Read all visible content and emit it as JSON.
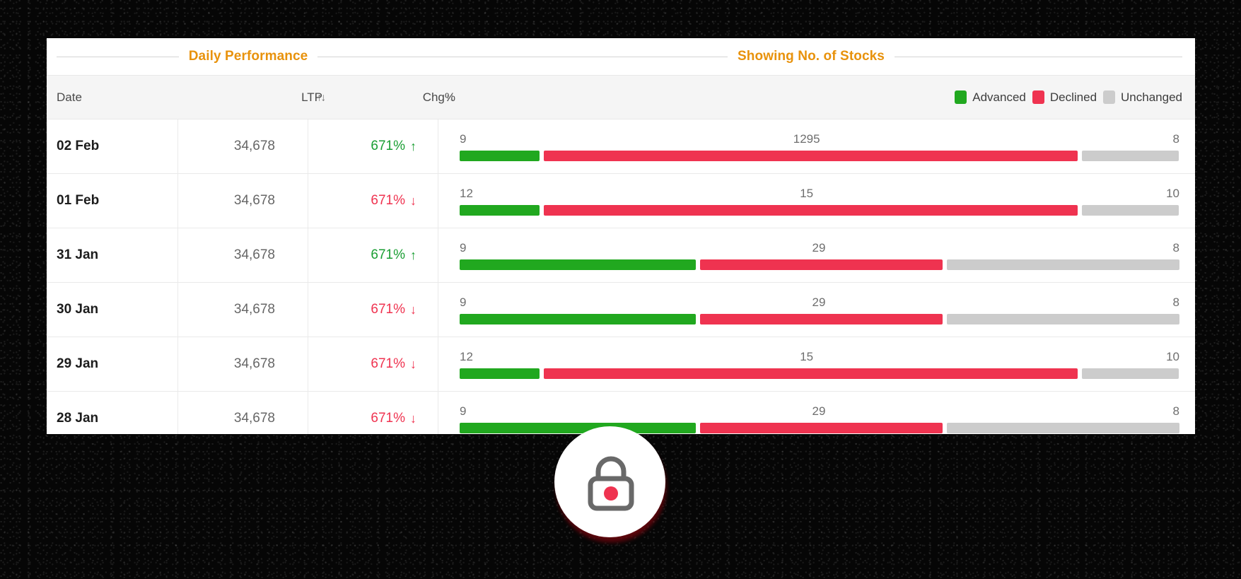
{
  "sections": {
    "left_title": "Daily Performance",
    "right_title": "Showing No. of Stocks",
    "accent_color": "#e8920c"
  },
  "table": {
    "columns": {
      "date": "Date",
      "ltp": "LTP",
      "chg": "Chg%",
      "sort_icon_ltp": "sort-updown-icon",
      "sort_icon_chg": "sort-updown-icon",
      "sort_glyph": "↑↓"
    },
    "legend": [
      {
        "label": "Advanced",
        "color": "#21a81f",
        "icon": "green-square-icon"
      },
      {
        "label": "Declined",
        "color": "#ef3350",
        "icon": "red-square-icon"
      },
      {
        "label": "Unchanged",
        "color": "#cccccc",
        "icon": "gray-square-icon"
      }
    ],
    "rows": [
      {
        "date": "02 Feb",
        "ltp": "34,678",
        "chg": "671%",
        "chg_direction": "up",
        "chg_arrow": "↑",
        "advanced": "9",
        "declined": "1295",
        "unchanged": "8",
        "adv_pct": 11.1,
        "dec_pct": 74.2,
        "unch_pct": 13.4
      },
      {
        "date": "01 Feb",
        "ltp": "34,678",
        "chg": "671%",
        "chg_direction": "down",
        "chg_arrow": "↓",
        "advanced": "12",
        "declined": "15",
        "unchanged": "10",
        "adv_pct": 11.1,
        "dec_pct": 74.2,
        "unch_pct": 13.4
      },
      {
        "date": "31 Jan",
        "ltp": "34,678",
        "chg": "671%",
        "chg_direction": "up",
        "chg_arrow": "↑",
        "advanced": "9",
        "declined": "29",
        "unchanged": "8",
        "adv_pct": 33.0,
        "dec_pct": 33.8,
        "unch_pct": 32.5
      },
      {
        "date": "30 Jan",
        "ltp": "34,678",
        "chg": "671%",
        "chg_direction": "down",
        "chg_arrow": "↓",
        "advanced": "9",
        "declined": "29",
        "unchanged": "8",
        "adv_pct": 33.0,
        "dec_pct": 33.8,
        "unch_pct": 32.5
      },
      {
        "date": "29 Jan",
        "ltp": "34,678",
        "chg": "671%",
        "chg_direction": "down",
        "chg_arrow": "↓",
        "advanced": "12",
        "declined": "15",
        "unchanged": "10",
        "adv_pct": 11.1,
        "dec_pct": 74.2,
        "unch_pct": 13.4
      },
      {
        "date": "28 Jan",
        "ltp": "34,678",
        "chg": "671%",
        "chg_direction": "down",
        "chg_arrow": "↓",
        "advanced": "9",
        "declined": "29",
        "unchanged": "8",
        "adv_pct": 33.0,
        "dec_pct": 33.8,
        "unch_pct": 32.5
      }
    ]
  },
  "overlay": {
    "icon": "lock-icon",
    "lock_outline_color": "#696969",
    "lock_keyhole_color": "#ef3350"
  },
  "chart_data": {
    "type": "bar",
    "title": "Showing No. of Stocks",
    "orientation": "horizontal-stacked",
    "categories": [
      "02 Feb",
      "01 Feb",
      "31 Jan",
      "30 Jan",
      "29 Jan",
      "28 Jan"
    ],
    "series": [
      {
        "name": "Advanced",
        "color": "#21a81f",
        "values": [
          9,
          12,
          9,
          9,
          12,
          9
        ]
      },
      {
        "name": "Declined",
        "color": "#ef3350",
        "values": [
          1295,
          15,
          29,
          29,
          15,
          29
        ]
      },
      {
        "name": "Unchanged",
        "color": "#cccccc",
        "values": [
          8,
          10,
          8,
          8,
          10,
          8
        ]
      }
    ],
    "legend_position": "top-right",
    "grid": false,
    "xlabel": "",
    "ylabel": ""
  }
}
